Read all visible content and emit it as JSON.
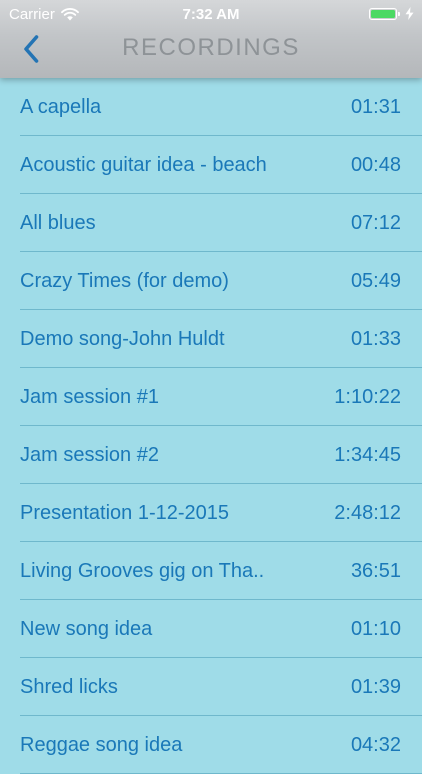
{
  "status_bar": {
    "carrier": "Carrier",
    "time": "7:32 AM",
    "battery_level": 1.0
  },
  "nav": {
    "title": "RECORDINGS",
    "back_icon": "chevron-left-icon"
  },
  "colors": {
    "background": "#9fdce8",
    "text": "#1a78b8",
    "title": "#8e9397",
    "battery_fill": "#4cd964",
    "separator": "#6fb8cc"
  },
  "recordings": [
    {
      "title": "A capella",
      "duration": "01:31"
    },
    {
      "title": "Acoustic guitar idea - beach",
      "duration": "00:48"
    },
    {
      "title": "All blues",
      "duration": "07:12"
    },
    {
      "title": "Crazy Times (for demo)",
      "duration": "05:49"
    },
    {
      "title": "Demo song-John Huldt",
      "duration": "01:33"
    },
    {
      "title": "Jam session #1",
      "duration": "1:10:22"
    },
    {
      "title": "Jam session #2",
      "duration": "1:34:45"
    },
    {
      "title": "Presentation 1-12-2015",
      "duration": "2:48:12"
    },
    {
      "title": "Living Grooves gig on Tha..",
      "duration": "36:51"
    },
    {
      "title": "New song idea",
      "duration": "01:10"
    },
    {
      "title": "Shred licks",
      "duration": "01:39"
    },
    {
      "title": "Reggae song idea",
      "duration": "04:32"
    }
  ]
}
